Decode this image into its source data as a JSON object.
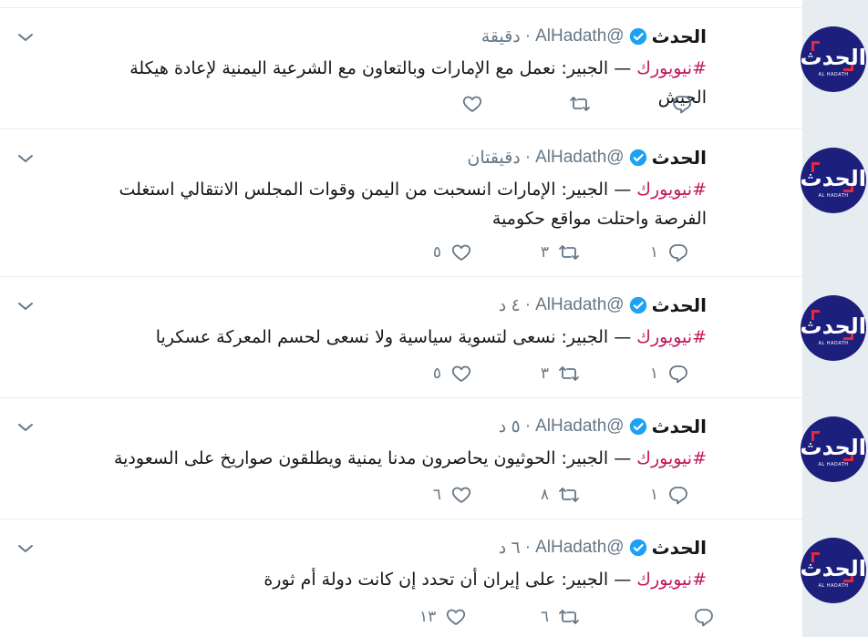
{
  "colors": {
    "hashtag": "#c2185b",
    "verified": "#1da1f2",
    "avatar_bg": "#1d1f7c",
    "avatar_red": "#e8273a"
  },
  "account": {
    "name": "الحدث",
    "handle": "@AlHadath",
    "avatar_text": "الحدث",
    "avatar_subtext": "AL HADATH"
  },
  "tweets": [
    {
      "time": "دقيقة",
      "separator": "·",
      "hashtag": "#نيويورك",
      "text": " — الجبير: نعمل مع الإمارات وبالتعاون مع الشرعية اليمنية لإعادة هيكلة الجيش",
      "replies": "",
      "retweets": "",
      "likes": ""
    },
    {
      "time": "دقيقتان",
      "separator": "·",
      "hashtag": "#نيويورك",
      "text": " — الجبير: الإمارات انسحبت من اليمن وقوات المجلس الانتقالي استغلت الفرصة واحتلت مواقع حكومية",
      "replies": "١",
      "retweets": "٣",
      "likes": "٥"
    },
    {
      "time": "٤ د",
      "separator": "·",
      "hashtag": "#نيويورك",
      "text": " — الجبير: نسعى لتسوية سياسية ولا نسعى لحسم المعركة عسكريا",
      "replies": "١",
      "retweets": "٣",
      "likes": "٥"
    },
    {
      "time": "٥ د",
      "separator": "·",
      "hashtag": "#نيويورك",
      "text": " — الجبير: الحوثيون يحاصرون مدنا يمنية ويطلقون صواريخ على السعودية",
      "replies": "١",
      "retweets": "٨",
      "likes": "٦"
    },
    {
      "time": "٦ د",
      "separator": "·",
      "hashtag": "#نيويورك",
      "text": " — الجبير: على إيران أن تحدد إن كانت دولة أم ثورة",
      "replies": "",
      "retweets": "٦",
      "likes": "١٣"
    }
  ]
}
